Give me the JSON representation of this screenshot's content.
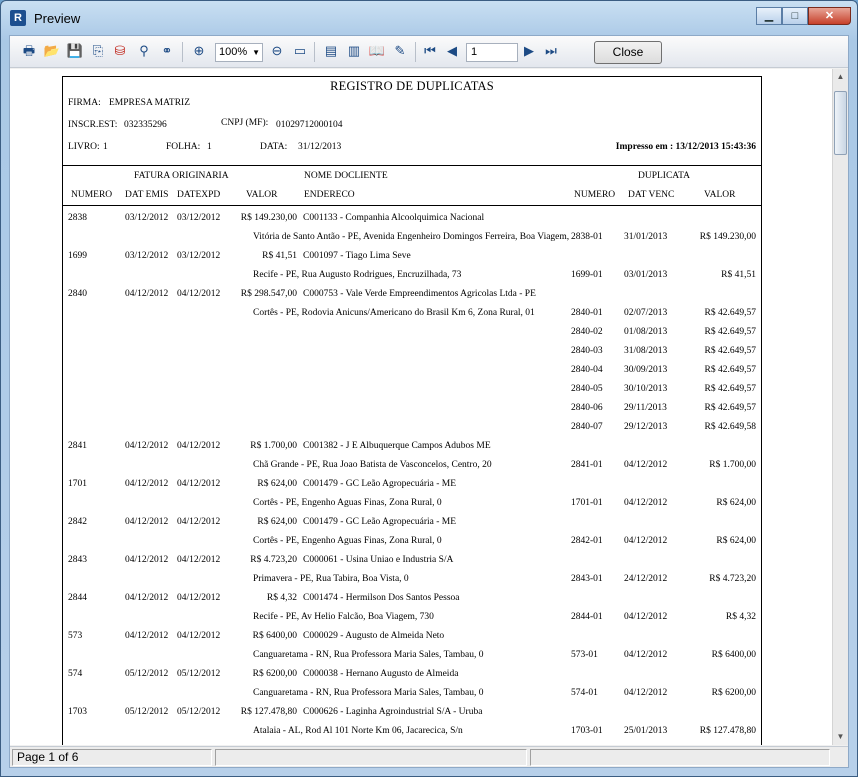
{
  "window": {
    "title": "Preview",
    "app_icon_glyph": "R",
    "minimize_glyph": "▁",
    "maximize_glyph": "□",
    "close_glyph": "✕"
  },
  "toolbar": {
    "icons": [
      "print-icon",
      "open-icon",
      "save-icon",
      "export-icon",
      "pdf-icon",
      "find-binoculars-icon",
      "find-next-icon",
      "zoom-in-icon",
      "zoom-out-icon",
      "page-width-icon",
      "single-page-icon",
      "multi-page-icon",
      "outline-icon",
      "edit-icon",
      "first-page-icon",
      "prev-page-icon",
      "next-page-icon",
      "last-page-icon"
    ],
    "zoom_value": "100%",
    "page_value": "1",
    "close_label": "Close"
  },
  "status": {
    "page_label": "Page 1 of 6"
  },
  "report": {
    "title": "REGISTRO DE DUPLICATAS",
    "firma_label": "FIRMA:",
    "firma_value": "EMPRESA MATRIZ",
    "inscr_label": "INSCR.EST:",
    "inscr_value": "032335296",
    "cnpj_label": "CNPJ (MF):",
    "cnpj_value": "01029712000104",
    "livro_label": "LIVRO:",
    "livro_value": "1",
    "folha_label": "FOLHA:",
    "folha_value": "1",
    "data_label": "DATA:",
    "data_value": "31/12/2013",
    "impresso": "Impresso em : 13/12/2013 15:43:36",
    "headers": {
      "fatura_originaria": "FATURA ORIGINARIA",
      "nome_cliente": "NOME DOCLIENTE",
      "duplicata": "DUPLICATA",
      "numero": "NUMERO",
      "dat_emis": "DAT EMIS",
      "dat_expd": "DATEXPD",
      "valor": "VALOR",
      "endereco": "ENDERECO",
      "dup_numero": "NUMERO",
      "dat_venc": "DAT VENC",
      "dup_valor": "VALOR"
    },
    "entries": [
      {
        "numero": "2838",
        "emis": "03/12/2012",
        "expd": "03/12/2012",
        "valor": "R$ 149.230,00",
        "cliente": "C001133 - Companhia Alcoolquimica Nacional",
        "endereco": "Vitória de Santo Antão - PE, Avenida Engenheiro Domingos Ferreira, Boa Viagem,",
        "dups": [
          {
            "num": "2838-01",
            "venc": "31/01/2013",
            "valor": "R$ 149.230,00"
          }
        ]
      },
      {
        "numero": "1699",
        "emis": "03/12/2012",
        "expd": "03/12/2012",
        "valor": "R$ 41,51",
        "cliente": "C001097 - Tiago Lima Seve",
        "endereco": "Recife - PE, Rua Augusto Rodrigues, Encruzilhada, 73",
        "dups": [
          {
            "num": "1699-01",
            "venc": "03/01/2013",
            "valor": "R$ 41,51"
          }
        ]
      },
      {
        "numero": "2840",
        "emis": "04/12/2012",
        "expd": "04/12/2012",
        "valor": "R$ 298.547,00",
        "cliente": "C000753 - Vale Verde Empreendimentos Agricolas Ltda - PE",
        "endereco": "Cortês - PE, Rodovia Anicuns/Americano do Brasil Km 6, Zona Rural, 01",
        "dups": [
          {
            "num": "2840-01",
            "venc": "02/07/2013",
            "valor": "R$ 42.649,57"
          },
          {
            "num": "2840-02",
            "venc": "01/08/2013",
            "valor": "R$ 42.649,57"
          },
          {
            "num": "2840-03",
            "venc": "31/08/2013",
            "valor": "R$ 42.649,57"
          },
          {
            "num": "2840-04",
            "venc": "30/09/2013",
            "valor": "R$ 42.649,57"
          },
          {
            "num": "2840-05",
            "venc": "30/10/2013",
            "valor": "R$ 42.649,57"
          },
          {
            "num": "2840-06",
            "venc": "29/11/2013",
            "valor": "R$ 42.649,57"
          },
          {
            "num": "2840-07",
            "venc": "29/12/2013",
            "valor": "R$ 42.649,58"
          }
        ]
      },
      {
        "numero": "2841",
        "emis": "04/12/2012",
        "expd": "04/12/2012",
        "valor": "R$ 1.700,00",
        "cliente": "C001382 - J E Albuquerque Campos Adubos ME",
        "endereco": "Chã Grande - PE, Rua Joao Batista de Vasconcelos, Centro, 20",
        "dups": [
          {
            "num": "2841-01",
            "venc": "04/12/2012",
            "valor": "R$ 1.700,00"
          }
        ]
      },
      {
        "numero": "1701",
        "emis": "04/12/2012",
        "expd": "04/12/2012",
        "valor": "R$ 624,00",
        "cliente": "C001479 - GC Leão Agropecuária - ME",
        "endereco": "Cortês - PE, Engenho Aguas Finas, Zona Rural, 0",
        "dups": [
          {
            "num": "1701-01",
            "venc": "04/12/2012",
            "valor": "R$ 624,00"
          }
        ]
      },
      {
        "numero": "2842",
        "emis": "04/12/2012",
        "expd": "04/12/2012",
        "valor": "R$ 624,00",
        "cliente": "C001479 - GC Leão Agropecuária - ME",
        "endereco": "Cortês - PE, Engenho Aguas Finas, Zona Rural, 0",
        "dups": [
          {
            "num": "2842-01",
            "venc": "04/12/2012",
            "valor": "R$ 624,00"
          }
        ]
      },
      {
        "numero": "2843",
        "emis": "04/12/2012",
        "expd": "04/12/2012",
        "valor": "R$ 4.723,20",
        "cliente": "C000061 - Usina Uniao e Industria S/A",
        "endereco": "Primavera - PE, Rua Tabira, Boa Vista, 0",
        "dups": [
          {
            "num": "2843-01",
            "venc": "24/12/2012",
            "valor": "R$ 4.723,20"
          }
        ]
      },
      {
        "numero": "2844",
        "emis": "04/12/2012",
        "expd": "04/12/2012",
        "valor": "R$ 4,32",
        "cliente": "C001474 - Hermilson Dos Santos Pessoa",
        "endereco": "Recife - PE, Av Helio Falcão, Boa Viagem, 730",
        "dups": [
          {
            "num": "2844-01",
            "venc": "04/12/2012",
            "valor": "R$ 4,32"
          }
        ]
      },
      {
        "numero": "573",
        "emis": "04/12/2012",
        "expd": "04/12/2012",
        "valor": "R$ 6400,00",
        "cliente": "C000029 - Augusto de Almeida Neto",
        "endereco": "Canguaretama - RN, Rua Professora Maria Sales, Tambau, 0",
        "dups": [
          {
            "num": "573-01",
            "venc": "04/12/2012",
            "valor": "R$ 6400,00"
          }
        ]
      },
      {
        "numero": "574",
        "emis": "05/12/2012",
        "expd": "05/12/2012",
        "valor": "R$ 6200,00",
        "cliente": "C000038 - Hernano Augusto de Almeida",
        "endereco": "Canguaretama - RN, Rua Professora Maria Sales, Tambau, 0",
        "dups": [
          {
            "num": "574-01",
            "venc": "04/12/2012",
            "valor": "R$ 6200,00"
          }
        ]
      },
      {
        "numero": "1703",
        "emis": "05/12/2012",
        "expd": "05/12/2012",
        "valor": "R$ 127.478,80",
        "cliente": "C000626 - Laginha Agroindustrial S/A - Uruba",
        "endereco": "Atalaia - AL, Rod Al 101 Norte Km 06, Jacarecica, S/n",
        "dups": [
          {
            "num": "1703-01",
            "venc": "25/01/2013",
            "valor": "R$ 127.478,80"
          }
        ]
      }
    ]
  }
}
